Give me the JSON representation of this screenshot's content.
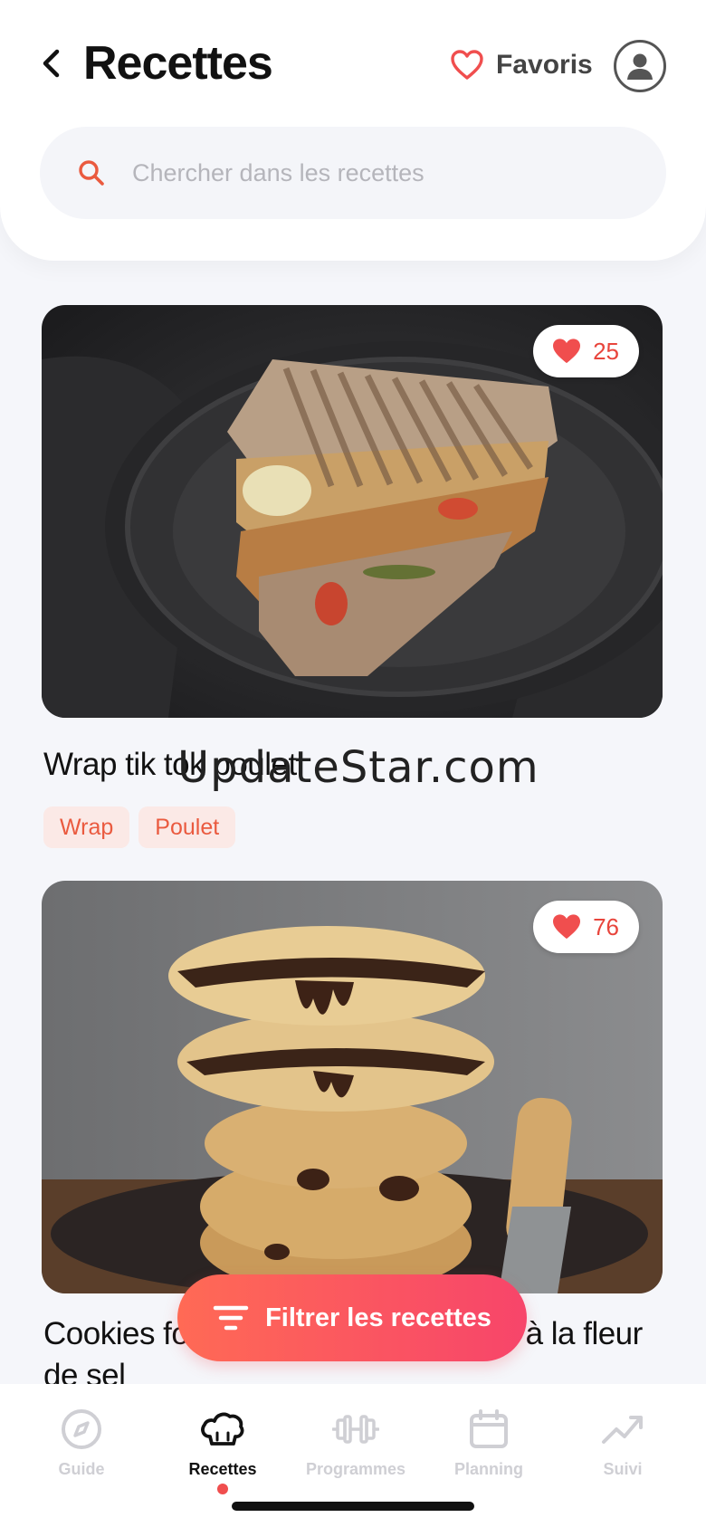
{
  "header": {
    "title": "Recettes",
    "favorites_label": "Favoris",
    "search_placeholder": "Chercher dans les recettes"
  },
  "recipes": [
    {
      "title": "Wrap tik tok poulet",
      "likes": "25",
      "tags": [
        "Wrap",
        "Poulet"
      ],
      "image": "wrap-sandwich-photo"
    },
    {
      "title": "Cookies fourrés au chocolat noir et à la fleur de sel",
      "likes": "76",
      "tags": [],
      "image": "stacked-cookies-photo"
    }
  ],
  "watermark": "UpdateStar.com",
  "filter_button_label": "Filtrer les recettes",
  "tabs": [
    {
      "label": "Guide",
      "icon": "compass-icon",
      "active": false
    },
    {
      "label": "Recettes",
      "icon": "chef-hat-icon",
      "active": true
    },
    {
      "label": "Programmes",
      "icon": "dumbbell-icon",
      "active": false
    },
    {
      "label": "Planning",
      "icon": "calendar-icon",
      "active": false
    },
    {
      "label": "Suivi",
      "icon": "trend-icon",
      "active": false
    }
  ],
  "colors": {
    "accent": "#f04e4e",
    "heart": "#f04e4e",
    "tag_bg": "#fbe9e6",
    "tag_text": "#ea5a3f",
    "filter_gradient_start": "#ff6a55",
    "filter_gradient_end": "#f7456a",
    "background": "#f5f6fa"
  }
}
